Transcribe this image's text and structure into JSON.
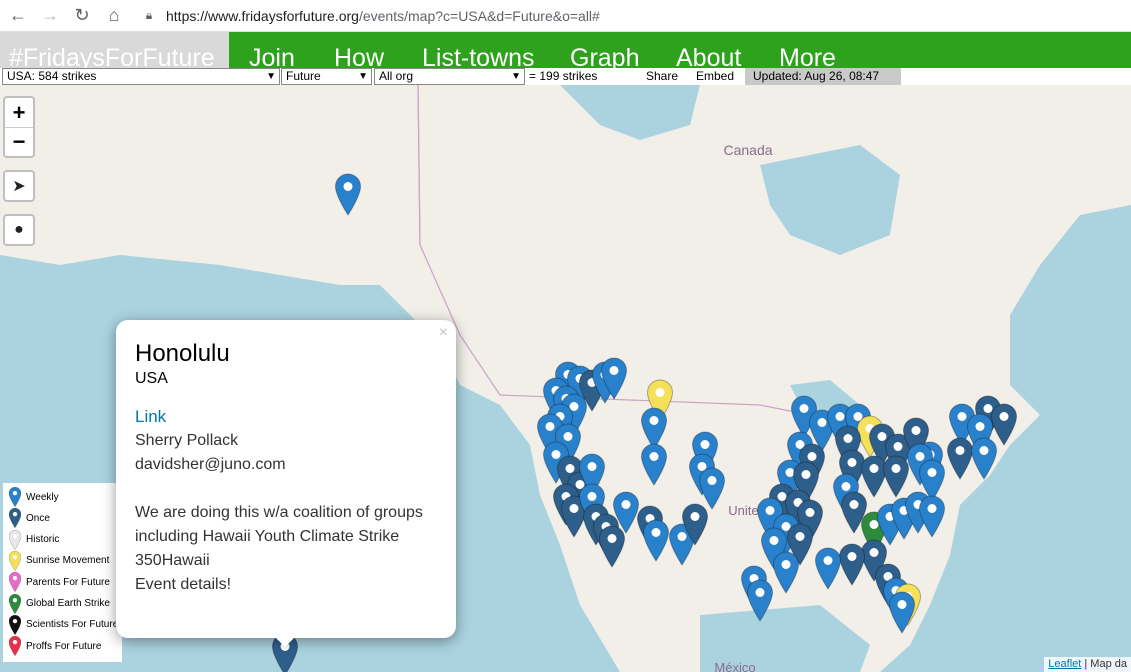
{
  "browser": {
    "url_host": "https://www.fridaysforfuture.org",
    "url_path": "/events/map?c=USA&d=Future&o=all#"
  },
  "nav": {
    "brand": "#FridaysForFuture",
    "items": [
      "Join",
      "How",
      "List-towns",
      "Graph",
      "About",
      "More"
    ]
  },
  "filters": {
    "country_select": "USA: 584 strikes",
    "date_select": "Future",
    "org_select": "All org",
    "count_text": "= 199 strikes",
    "share_label": "Share",
    "embed_label": "Embed",
    "updated_text": "Updated: Aug 26, 08:47"
  },
  "map": {
    "labels": {
      "canada": "Canada",
      "united_states": "United St",
      "mexico": "México"
    },
    "zoom_in": "+",
    "zoom_out": "−",
    "attribution_link": "Leaflet",
    "attribution_text": "| Map da"
  },
  "legend": [
    {
      "label": "Weekly",
      "color": "#2a81cb"
    },
    {
      "label": "Once",
      "color": "#2e5f8b"
    },
    {
      "label": "Historic",
      "color": "#e8e8e8"
    },
    {
      "label": "Sunrise Movement",
      "color": "#f5e05a"
    },
    {
      "label": "Parents For Future",
      "color": "#e86bc9"
    },
    {
      "label": "Global Earth Strike",
      "color": "#2e8b3e"
    },
    {
      "label": "Scientists For Future",
      "color": "#111111"
    },
    {
      "label": "Proffs For Future",
      "color": "#e8304a"
    }
  ],
  "popup": {
    "close": "×",
    "city": "Honolulu",
    "country": "USA",
    "link_label": "Link",
    "contact_name": "Sherry Pollack",
    "contact_email": "davidsher@juno.com",
    "description": "We are doing this w/a coalition of groups including Hawaii Youth Climate Strike",
    "org": "350Hawaii",
    "details_label": "Event details!"
  }
}
